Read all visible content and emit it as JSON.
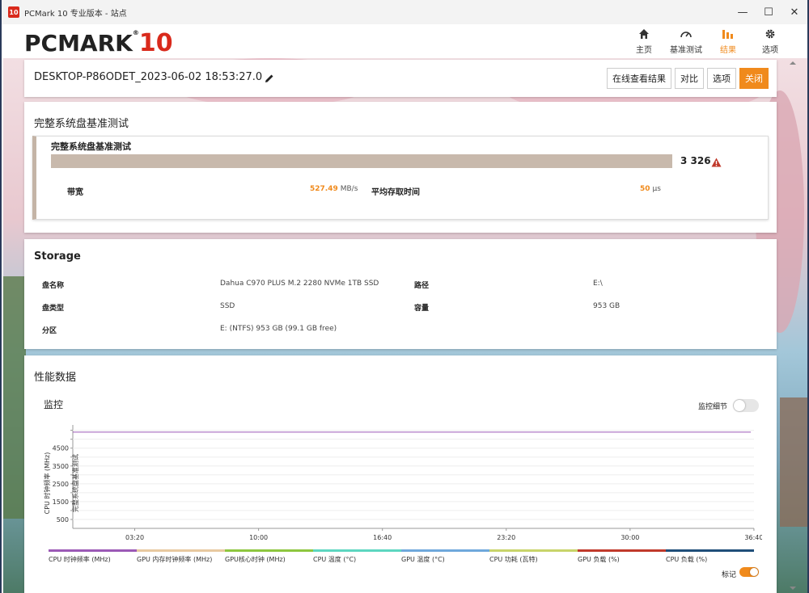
{
  "window": {
    "title": "PCMark 10 专业版本 - 站点",
    "app_icon_text": "10",
    "controls": {
      "minimize": "—",
      "maximize": "☐",
      "close": "✕"
    }
  },
  "header": {
    "logo_main": "PCMARK",
    "logo_num": "10",
    "logo_reg": "®",
    "nav": [
      {
        "label": "主页",
        "icon": "home-icon"
      },
      {
        "label": "基准测试",
        "icon": "gauge-icon"
      },
      {
        "label": "结果",
        "icon": "bar-chart-icon",
        "active": true
      },
      {
        "label": "选项",
        "icon": "gear-icon"
      }
    ],
    "accent": "#f08a1c"
  },
  "run": {
    "name": "DESKTOP-P86ODET_2023-06-02 18:53:27.0",
    "buttons": {
      "online": "在线查看结果",
      "compare": "对比",
      "options": "选项",
      "close": "关闭"
    }
  },
  "test": {
    "section_title": "完整系统盘基准测试",
    "card_title": "完整系统盘基准测试",
    "score": "3 326",
    "bandwidth_label": "带宽",
    "bandwidth_value": "527.49",
    "bandwidth_unit": "MB/s",
    "latency_label": "平均存取时间",
    "latency_value": "50",
    "latency_unit": "µs"
  },
  "storage": {
    "title": "Storage",
    "rows": [
      {
        "k1": "盘名称",
        "v1": "Dahua C970 PLUS M.2 2280 NVMe 1TB SSD",
        "k2": "路径",
        "v2": "E:\\"
      },
      {
        "k1": "盘类型",
        "v1": "SSD",
        "k2": "容量",
        "v2": "953 GB"
      },
      {
        "k1": "分区",
        "v1": "E: (NTFS) 953 GB (99.1 GB free)",
        "k2": "",
        "v2": ""
      }
    ]
  },
  "perf": {
    "title": "性能数据",
    "monitor_title": "监控",
    "details_toggle_label": "监控细节",
    "markers_label": "标记",
    "legend": [
      {
        "label": "CPU 时钟频率 (MHz)",
        "color": "#9b59b6"
      },
      {
        "label": "GPU 内存时钟频率 (MHz)",
        "color": "#e8c9a0"
      },
      {
        "label": "GPU核心时钟 (MHz)",
        "color": "#8dc63f"
      },
      {
        "label": "CPU 温度 (°C)",
        "color": "#5dd6c0"
      },
      {
        "label": "GPU 温度 (°C)",
        "color": "#6fa8dc"
      },
      {
        "label": "CPU 功耗 (瓦特)",
        "color": "#c8d46a"
      },
      {
        "label": "GPU 负载 (%)",
        "color": "#c0392b"
      },
      {
        "label": "CPU 负载 (%)",
        "color": "#1f4e79"
      }
    ]
  },
  "chart_data": {
    "type": "line",
    "ylabel": "CPU 时钟频率 (MHz)",
    "annotation": "完整系统盘基准测试",
    "x_ticks": [
      "03:20",
      "10:00",
      "16:40",
      "23:20",
      "30:00",
      "36:40"
    ],
    "y_ticks": [
      500,
      1500,
      2500,
      3500,
      4500
    ],
    "ylim": [
      0,
      5800
    ],
    "series": [
      {
        "name": "CPU 时钟频率 (MHz)",
        "x": [
          0,
          36.5
        ],
        "values": [
          5400,
          5400
        ],
        "color": "#9b59b6"
      }
    ]
  }
}
